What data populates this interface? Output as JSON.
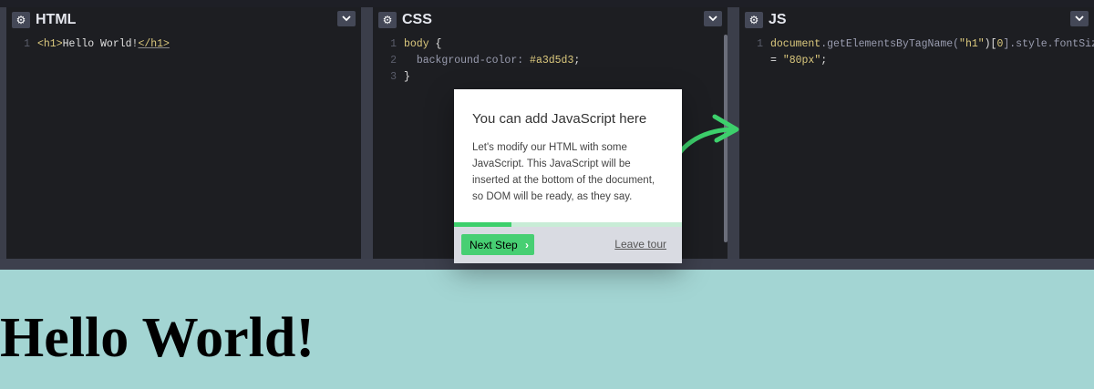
{
  "panes": {
    "html": {
      "title": "HTML"
    },
    "css": {
      "title": "CSS"
    },
    "js": {
      "title": "JS"
    }
  },
  "icons": {
    "settings": "gear-icon",
    "collapse": "chevron-down-icon",
    "next": "chevron-right-icon",
    "arrow": "curved-arrow-icon"
  },
  "html_code": {
    "ln1": "1",
    "open_tag": "<h1>",
    "text": "Hello World!",
    "close_tag": "</h1>"
  },
  "css_code": {
    "ln1": "1",
    "ln2": "2",
    "ln3": "3",
    "selector": "body",
    "open_brace": " {",
    "property": "background-color: ",
    "value": "#a3d5d3",
    "semicolon": ";",
    "close_brace": "}"
  },
  "js_code": {
    "ln1": "1",
    "obj": "document",
    "method": ".getElementsByTagName(",
    "arg": "\"h1\"",
    "idx_open": ")[",
    "idx": "0",
    "tail": "].style.fontSize",
    "eq": "= ",
    "value": "\"80px\"",
    "end": ";"
  },
  "tour": {
    "heading": "You can add JavaScript here",
    "body": "Let's modify our HTML with some JavaScript. This JavaScript will be inserted at the bottom of the document, so DOM will be ready, as they say.",
    "next_label": "Next Step",
    "leave_label": "Leave tour",
    "progress": 0.25
  },
  "output": {
    "heading": "Hello World!"
  },
  "colors": {
    "accent": "#47cf73",
    "output_background": "#a3d5d3",
    "editor_background": "#1d1e22"
  }
}
